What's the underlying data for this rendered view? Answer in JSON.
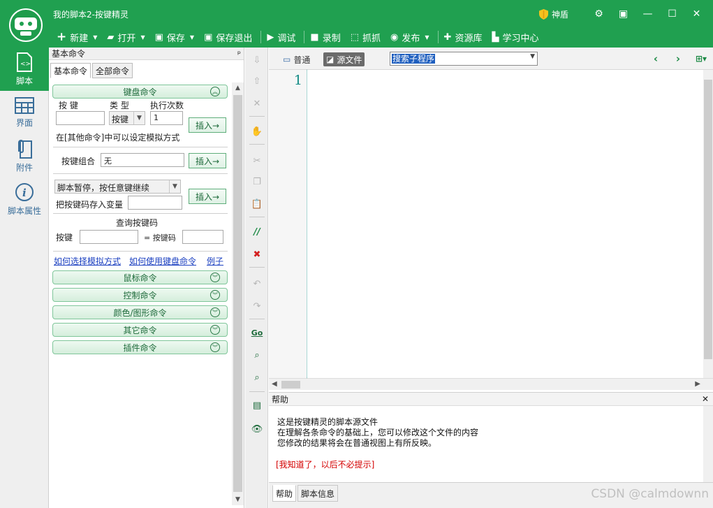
{
  "window": {
    "title": "我的脚本2-按键精灵",
    "shield_label": "神盾"
  },
  "toolbar": [
    {
      "label": "新建",
      "icon": "plus-icon",
      "dropdown": true
    },
    {
      "label": "打开",
      "icon": "folder-icon",
      "dropdown": true
    },
    {
      "label": "保存",
      "icon": "save-icon",
      "dropdown": true
    },
    {
      "label": "保存退出",
      "icon": "save-exit-icon",
      "dropdown": false
    },
    {
      "label": "调试",
      "icon": "play-icon",
      "dropdown": false
    },
    {
      "label": "录制",
      "icon": "record-icon",
      "dropdown": false
    },
    {
      "label": "抓抓",
      "icon": "capture-icon",
      "dropdown": false
    },
    {
      "label": "发布",
      "icon": "publish-icon",
      "dropdown": true
    },
    {
      "label": "资源库",
      "icon": "resource-icon",
      "dropdown": false
    },
    {
      "label": "学习中心",
      "icon": "book-icon",
      "dropdown": false
    }
  ],
  "leftnav": [
    {
      "label": "脚本",
      "icon": "script-file-icon",
      "active": true
    },
    {
      "label": "界面",
      "icon": "grid-icon",
      "active": false
    },
    {
      "label": "附件",
      "icon": "paperclip-icon",
      "active": false
    },
    {
      "label": "脚本属性",
      "icon": "info-icon",
      "active": false
    }
  ],
  "cmd_panel": {
    "header": "基本命令",
    "pin": "ᵖ",
    "tabs": [
      "基本命令",
      "全部命令"
    ],
    "keyboard_section": "键盘命令",
    "key_label": "按 键",
    "type_label": "类 型",
    "count_label": "执行次数",
    "type_value": "按键",
    "count_value": "1",
    "insert_label": "插入→",
    "sim_hint": "在[其他命令]中可以设定模拟方式",
    "combo_label": "按键组合",
    "combo_value": "无",
    "pause_value": "脚本暂停，按任意键继续",
    "save_var_label": "把按键码存入变量",
    "query_label": "查询按键码",
    "query_key_label": "按键",
    "query_code_label": "= 按键码",
    "links": [
      "如何选择模拟方式",
      "如何使用键盘命令",
      "例子"
    ],
    "sections": [
      "鼠标命令",
      "控制命令",
      "颜色/图形命令",
      "其它命令",
      "插件命令"
    ]
  },
  "editor": {
    "view_normal": "普通",
    "view_source": "源文件",
    "sub_search": "搜索子程序",
    "line_number": "1"
  },
  "help": {
    "title": "帮助",
    "lines": [
      "这是按键精灵的脚本源文件",
      "在理解各条命令的基础上，您可以修改这个文件的内容",
      "您修改的结果将会在普通视图上有所反映。"
    ],
    "note": "[我知道了，以后不必提示]",
    "tabs": [
      "帮助",
      "脚本信息"
    ]
  },
  "watermark": "CSDN @calmdownn",
  "colors": {
    "brand_green": "#20a050",
    "link_blue": "#1a3fc0",
    "note_red": "#d40000",
    "line_number": "#118a84"
  }
}
